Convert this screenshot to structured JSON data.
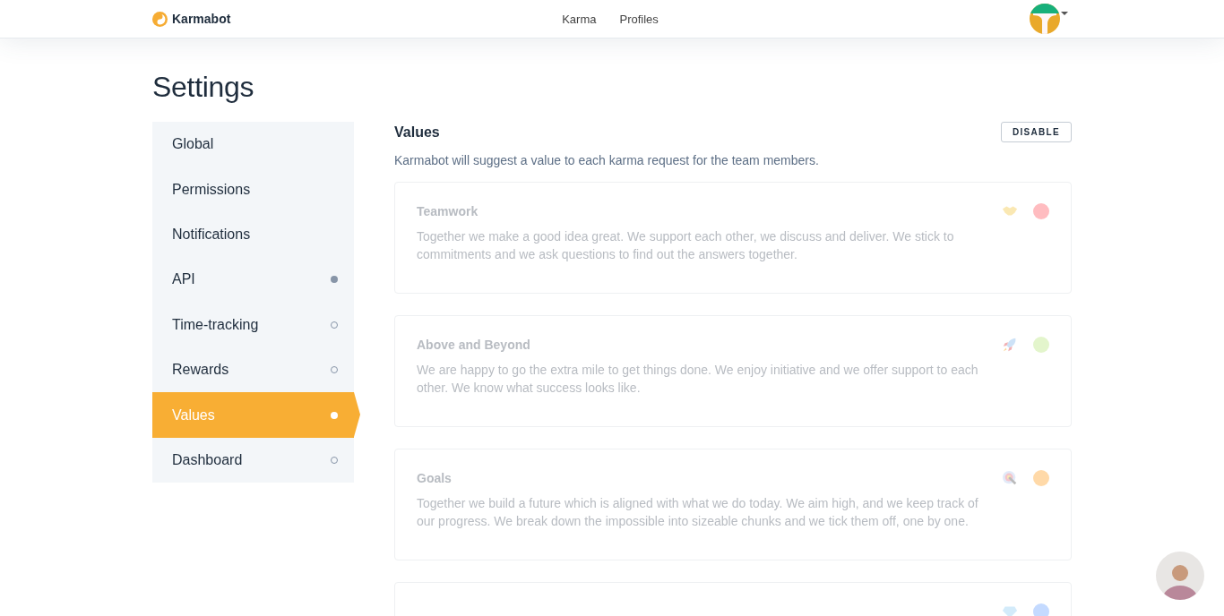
{
  "header": {
    "brand": "Karmabot",
    "nav": [
      {
        "label": "Karma"
      },
      {
        "label": "Profiles"
      }
    ]
  },
  "page_title": "Settings",
  "sidebar": {
    "items": [
      {
        "label": "Global",
        "selected": false
      },
      {
        "label": "Permissions",
        "selected": false
      },
      {
        "label": "Notifications",
        "selected": false
      },
      {
        "label": "API",
        "selected": false,
        "active": true
      },
      {
        "label": "Time-tracking",
        "selected": false,
        "active": false
      },
      {
        "label": "Rewards",
        "selected": false,
        "active": false
      },
      {
        "label": "Values",
        "selected": true,
        "active": true
      },
      {
        "label": "Dashboard",
        "selected": false,
        "active": false
      }
    ]
  },
  "section": {
    "title": "Values",
    "button": "DISABLE",
    "description": "Karmabot will suggest a value to each karma request for the team members.",
    "values": [
      {
        "kind": "handshake",
        "title": "Teamwork",
        "description": "Together we make a good idea great. We support each other, we discuss and deliver. We stick to commitments and we ask questions to find out the answers together.",
        "color": "#ffbcc0",
        "disabled": true
      },
      {
        "kind": "rocket",
        "title": "Above and Beyond",
        "description": "We are happy to go the extra mile to get things done. We enjoy initiative and we offer support to each other. We know what success looks like.",
        "color": "#e3f5cc",
        "disabled": true
      },
      {
        "kind": "target",
        "title": "Goals",
        "description": "Together we build a future which is aligned with what we do today. We aim high, and we keep track of our progress. We break down the impossible into sizeable chunks and we tick them off, one by one.",
        "color": "#ffd9a8",
        "disabled": true
      },
      {
        "kind": "gem",
        "color": "#c4daff",
        "disabled": true
      }
    ]
  }
}
